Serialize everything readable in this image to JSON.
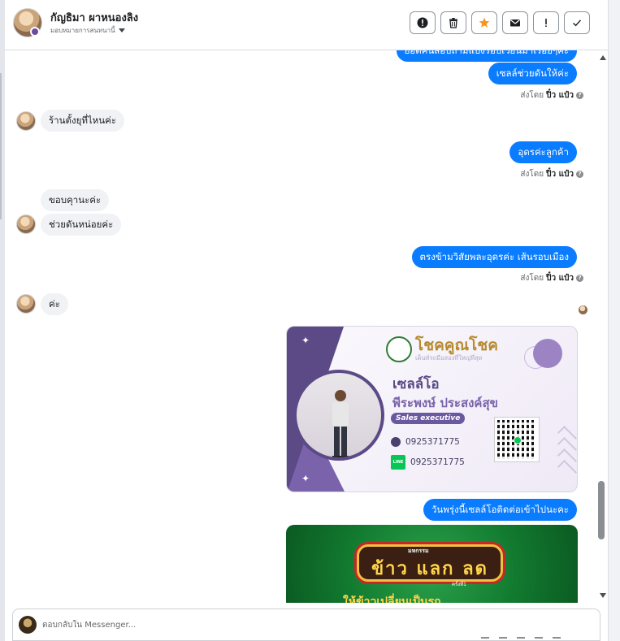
{
  "header": {
    "contact_name": "กัญธิมา ผาหนองลิง",
    "assign_label": "มอบหมายการสนทนานี้",
    "tools": [
      {
        "name": "alert-circle-icon",
        "glyph": "!"
      },
      {
        "name": "trash-icon",
        "glyph": ""
      },
      {
        "name": "star-icon",
        "glyph": "★"
      },
      {
        "name": "envelope-icon",
        "glyph": "✉"
      },
      {
        "name": "exclamation-icon",
        "glyph": "!"
      },
      {
        "name": "check-icon",
        "glyph": "✓"
      }
    ]
  },
  "messages": {
    "m0": "ยอดคนสอบถามแบ่งรอบเวียนมาเรื่อยๆค่ะ",
    "m1": "เซลล์ช่วยดันให้ค่ะ",
    "m2": "ร้านตั้งยุที่ไหนค่ะ",
    "m3": "อุดรค่ะลูกค้า",
    "m4": "ขอบคุานะค่ะ",
    "m5": "ช่วยดันหน่อยค่ะ",
    "m6": "ตรงข้ามวิสัยพละอุดรค่ะ เส้นรอบเมือง",
    "m7": "ค่ะ",
    "m8": "วันพรุ่งนี้เซลล์โอติดต่อเข้าไปนะคะ"
  },
  "sent_by": {
    "prefix": "ส่งโดย",
    "name": "ปิ๋ว แป๋ว",
    "help": "?"
  },
  "business_card": {
    "brand": "โชคคูณโชค",
    "tagline": "เต็นท์รถมือสองที่ใหญ่ที่สุด",
    "nickname": "เซลล์โอ",
    "full_name": "พีระพงษ์ ประสงค์สุข",
    "role": "Sales executive",
    "phone": "0925371775",
    "line_id": "0925371775",
    "line_label": "LINE"
  },
  "promo": {
    "top_label": "มหกรรม",
    "headline": "ข้าว แลก ลด",
    "sub_label": "ครั้งที่1",
    "bottom": "ให้ข้าวเปลี่ยนเป็นรถ"
  },
  "composer": {
    "placeholder": "ตอบกลับใน Messenger..."
  }
}
